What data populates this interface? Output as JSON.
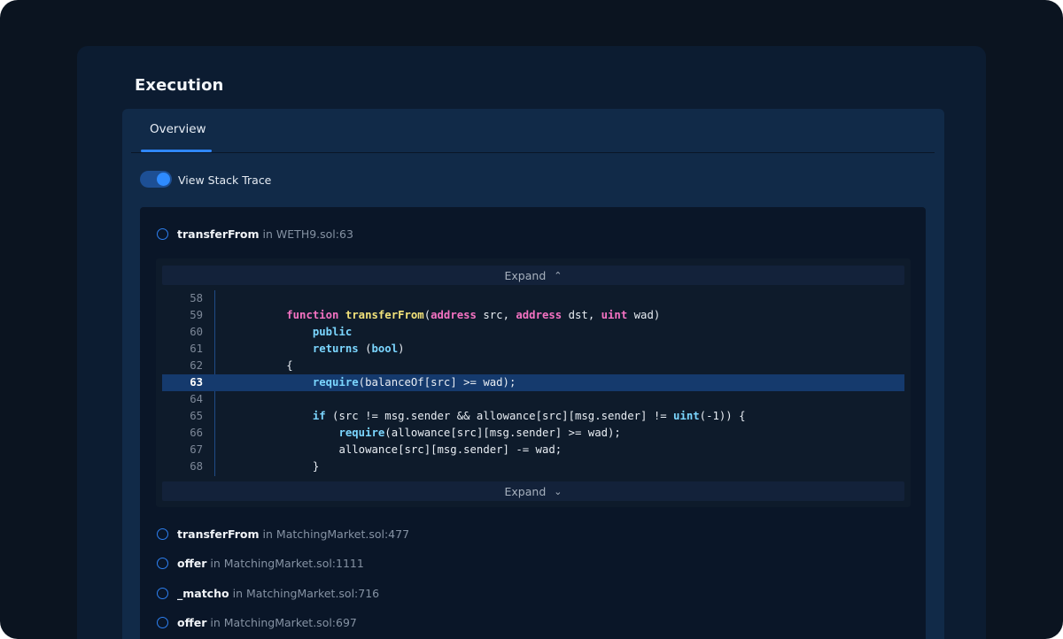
{
  "section": {
    "title": "Execution"
  },
  "tabs": [
    {
      "label": "Overview",
      "active": true
    }
  ],
  "toggle": {
    "label": "View Stack Trace",
    "on": true
  },
  "stack_trace": [
    {
      "function": "transferFrom",
      "connector": "in",
      "location": "WETH9.sol:63"
    },
    {
      "function": "transferFrom",
      "connector": "in",
      "location": "MatchingMarket.sol:477"
    },
    {
      "function": "offer",
      "connector": "in",
      "location": "MatchingMarket.sol:1111"
    },
    {
      "function": "_matcho",
      "connector": "in",
      "location": "MatchingMarket.sol:716"
    },
    {
      "function": "offer",
      "connector": "in",
      "location": "MatchingMarket.sol:697"
    }
  ],
  "code_view": {
    "expand_up_label": "Expand",
    "expand_down_label": "Expand",
    "highlighted_line": "63",
    "lines": [
      {
        "num": "58",
        "tokens": []
      },
      {
        "num": "59",
        "tokens": [
          {
            "t": "        "
          },
          {
            "t": "function",
            "c": "kw"
          },
          {
            "t": " "
          },
          {
            "t": "transferFrom",
            "c": "fn"
          },
          {
            "t": "("
          },
          {
            "t": "address",
            "c": "kw"
          },
          {
            "t": " src, "
          },
          {
            "t": "address",
            "c": "kw"
          },
          {
            "t": " dst, "
          },
          {
            "t": "uint",
            "c": "kw"
          },
          {
            "t": " wad)"
          }
        ]
      },
      {
        "num": "60",
        "tokens": [
          {
            "t": "            "
          },
          {
            "t": "public",
            "c": "bi"
          }
        ]
      },
      {
        "num": "61",
        "tokens": [
          {
            "t": "            "
          },
          {
            "t": "returns",
            "c": "bi"
          },
          {
            "t": " ("
          },
          {
            "t": "bool",
            "c": "bi"
          },
          {
            "t": ")"
          }
        ]
      },
      {
        "num": "62",
        "tokens": [
          {
            "t": "        {"
          }
        ]
      },
      {
        "num": "63",
        "tokens": [
          {
            "t": "            "
          },
          {
            "t": "require",
            "c": "bi"
          },
          {
            "t": "(balanceOf[src] >= wad);"
          }
        ]
      },
      {
        "num": "64",
        "tokens": []
      },
      {
        "num": "65",
        "tokens": [
          {
            "t": "            "
          },
          {
            "t": "if",
            "c": "bi"
          },
          {
            "t": " (src != msg.sender && allowance[src][msg.sender] != "
          },
          {
            "t": "uint",
            "c": "bi"
          },
          {
            "t": "(-1)) {"
          }
        ]
      },
      {
        "num": "66",
        "tokens": [
          {
            "t": "                "
          },
          {
            "t": "require",
            "c": "bi"
          },
          {
            "t": "(allowance[src][msg.sender] >= wad);"
          }
        ]
      },
      {
        "num": "67",
        "tokens": [
          {
            "t": "                allowance[src][msg.sender] -= wad;"
          }
        ]
      },
      {
        "num": "68",
        "tokens": [
          {
            "t": "            }"
          }
        ]
      }
    ]
  },
  "icons": {
    "expand_up": "chevron-double-up-icon",
    "expand_down": "chevron-double-down-icon"
  },
  "colors": {
    "accent": "#2f86ff",
    "keyword": "#f472c2",
    "function_name": "#f2e27a",
    "builtin": "#7bd6ff",
    "highlight_row": "#153a6d"
  }
}
